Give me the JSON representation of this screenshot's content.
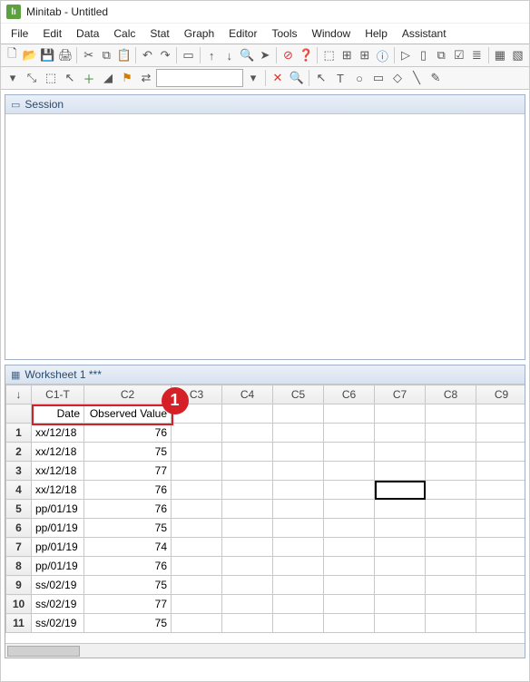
{
  "app": {
    "title": "Minitab - Untitled"
  },
  "menu": [
    "File",
    "Edit",
    "Data",
    "Calc",
    "Stat",
    "Graph",
    "Editor",
    "Tools",
    "Window",
    "Help",
    "Assistant"
  ],
  "toolbar1": [
    {
      "name": "new-icon",
      "g": "🗋"
    },
    {
      "name": "open-icon",
      "g": "📂"
    },
    {
      "name": "save-icon",
      "g": "💾"
    },
    {
      "name": "print-icon",
      "g": "🖨"
    },
    {
      "name": "sep"
    },
    {
      "name": "cut-icon",
      "g": "✂"
    },
    {
      "name": "copy-icon",
      "g": "⧉"
    },
    {
      "name": "paste-icon",
      "g": "📋"
    },
    {
      "name": "sep"
    },
    {
      "name": "undo-icon",
      "g": "↶"
    },
    {
      "name": "redo-icon",
      "g": "↷"
    },
    {
      "name": "sep"
    },
    {
      "name": "new-window-icon",
      "g": "▭"
    },
    {
      "name": "sep"
    },
    {
      "name": "arrow-up-icon",
      "g": "↑"
    },
    {
      "name": "arrow-down-icon",
      "g": "↓"
    },
    {
      "name": "find-icon",
      "g": "🔍"
    },
    {
      "name": "pointer-icon",
      "g": "➤"
    },
    {
      "name": "sep"
    },
    {
      "name": "cancel-icon",
      "g": "⊘",
      "color": "#d33"
    },
    {
      "name": "help-icon",
      "g": "❓",
      "color": "#1e6fc8"
    },
    {
      "name": "sep"
    },
    {
      "name": "tool-a-icon",
      "g": "⬚"
    },
    {
      "name": "tool-b-icon",
      "g": "⊞"
    },
    {
      "name": "tool-c-icon",
      "g": "⊞"
    },
    {
      "name": "info-icon",
      "g": "ⓘ",
      "color": "#1e6fc8"
    },
    {
      "name": "sep"
    },
    {
      "name": "play-icon",
      "g": "▷"
    },
    {
      "name": "doc-icon",
      "g": "▯"
    },
    {
      "name": "layers-icon",
      "g": "⧉"
    },
    {
      "name": "check-icon",
      "g": "☑"
    },
    {
      "name": "list-icon",
      "g": "≣"
    },
    {
      "name": "sep"
    },
    {
      "name": "grid-icon",
      "g": "▦"
    },
    {
      "name": "chart-icon",
      "g": "▧"
    }
  ],
  "toolbar2_left": [
    {
      "name": "dropdown-icon",
      "g": "▾"
    },
    {
      "name": "drag-icon",
      "g": "⤡"
    },
    {
      "name": "select-icon",
      "g": "⬚"
    },
    {
      "name": "cursor-icon",
      "g": "↖"
    },
    {
      "name": "plus-icon",
      "g": "＋",
      "color": "#2a8a2a"
    },
    {
      "name": "brush-icon",
      "g": "◢"
    },
    {
      "name": "flag-icon",
      "g": "⚑",
      "color": "#d08000"
    },
    {
      "name": "swap-icon",
      "g": "⇄"
    }
  ],
  "toolbar2_input": {
    "value": ""
  },
  "toolbar2_right": [
    {
      "name": "dropdown2-icon",
      "g": "▾"
    },
    {
      "name": "sep"
    },
    {
      "name": "close-icon",
      "g": "✕",
      "color": "#d33"
    },
    {
      "name": "zoom-icon",
      "g": "🔍"
    },
    {
      "name": "sep"
    },
    {
      "name": "arrow-tool-icon",
      "g": "↖"
    },
    {
      "name": "text-tool-icon",
      "g": "T"
    },
    {
      "name": "oval-tool-icon",
      "g": "○"
    },
    {
      "name": "rect-tool-icon",
      "g": "▭"
    },
    {
      "name": "poly-tool-icon",
      "g": "◇"
    },
    {
      "name": "line-tool-icon",
      "g": "╲"
    },
    {
      "name": "marker-tool-icon",
      "g": "✎"
    }
  ],
  "session": {
    "title": "Session"
  },
  "worksheet": {
    "title": "Worksheet 1 ***",
    "corner": "↓",
    "col_headers": [
      "C1-T",
      "C2",
      "C3",
      "C4",
      "C5",
      "C6",
      "C7",
      "C8",
      "C9"
    ],
    "col_names": [
      "Date",
      "Observed Value",
      "",
      "",
      "",
      "",
      "",
      "",
      ""
    ],
    "rows": [
      {
        "n": "1",
        "date": "xx/12/18",
        "val": "76"
      },
      {
        "n": "2",
        "date": "xx/12/18",
        "val": "75"
      },
      {
        "n": "3",
        "date": "xx/12/18",
        "val": "77"
      },
      {
        "n": "4",
        "date": "xx/12/18",
        "val": "76"
      },
      {
        "n": "5",
        "date": "pp/01/19",
        "val": "76"
      },
      {
        "n": "6",
        "date": "pp/01/19",
        "val": "75"
      },
      {
        "n": "7",
        "date": "pp/01/19",
        "val": "74"
      },
      {
        "n": "8",
        "date": "pp/01/19",
        "val": "76"
      },
      {
        "n": "9",
        "date": "ss/02/19",
        "val": "75"
      },
      {
        "n": "10",
        "date": "ss/02/19",
        "val": "77"
      },
      {
        "n": "11",
        "date": "ss/02/19",
        "val": "75"
      }
    ],
    "selected": {
      "row": 4,
      "col": "C7"
    }
  },
  "callout": {
    "label": "1"
  }
}
